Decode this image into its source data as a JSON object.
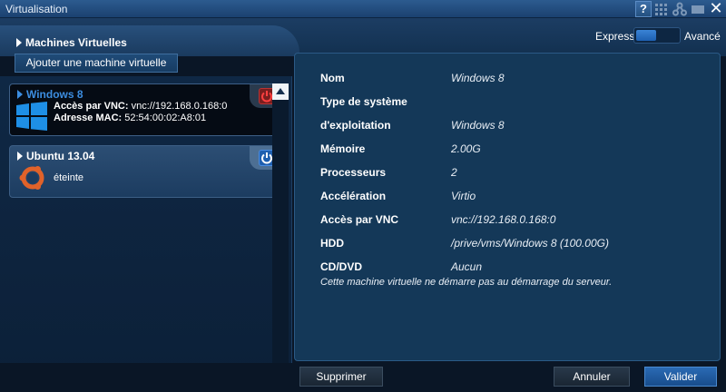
{
  "window": {
    "title": "Virtualisation"
  },
  "titlebar": {
    "help_label": "?",
    "close_label": "✕"
  },
  "mode": {
    "express": "Express",
    "advanced": "Avancé"
  },
  "sidebar": {
    "title": "Machines Virtuelles",
    "add_button": "Ajouter une machine virtuelle",
    "vms": [
      {
        "name": "Windows 8",
        "vnc_label": "Accès par VNC:",
        "vnc_value": "vnc://192.168.0.168:0",
        "mac_label": "Adresse MAC:",
        "mac_value": "52:54:00:02:A8:01",
        "selected": true,
        "power": "on",
        "os_icon": "windows-icon"
      },
      {
        "name": "Ubuntu 13.04",
        "state": "éteinte",
        "selected": false,
        "power": "off",
        "os_icon": "ubuntu-icon"
      }
    ]
  },
  "details": {
    "rows": [
      {
        "label": "Nom",
        "value": "Windows 8"
      },
      {
        "label": "Type de système",
        "value": ""
      },
      {
        "label": "d'exploitation",
        "value": "Windows 8"
      },
      {
        "label": "Mémoire",
        "value": "2.00G"
      },
      {
        "label": "Processeurs",
        "value": "2"
      },
      {
        "label": "Accélération",
        "value": "Virtio"
      },
      {
        "label": "Accès par VNC",
        "value": "vnc://192.168.0.168:0"
      },
      {
        "label": "HDD",
        "value": "/prive/vms/Windows 8 (100.00G)"
      },
      {
        "label": "CD/DVD",
        "value": "Aucun"
      }
    ],
    "note": "Cette machine virtuelle ne démarre pas au démarrage du serveur."
  },
  "buttons": {
    "delete": "Supprimer",
    "cancel": "Annuler",
    "ok": "Valider"
  },
  "colors": {
    "accent": "#3c8de0",
    "power_on": "#b33333",
    "power_off": "#1e5fb0"
  }
}
